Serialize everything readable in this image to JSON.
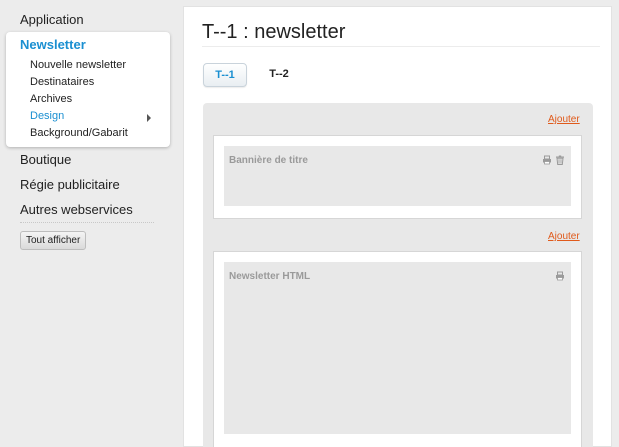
{
  "sidebar": {
    "items": {
      "application": "Application",
      "boutique": "Boutique",
      "regie": "Régie publicitaire",
      "autres": "Autres webservices"
    },
    "active": {
      "title": "Newsletter",
      "sub_items": {
        "nouvelle": "Nouvelle newsletter",
        "destinataires": "Destinataires",
        "archives": "Archives",
        "design": "Design",
        "background": "Background/Gabarit"
      }
    },
    "show_all_label": "Tout afficher"
  },
  "main": {
    "title": "T--1 : newsletter",
    "tabs": {
      "active": "T--1",
      "inactive": "T--2"
    },
    "add_label_1": "Ajouter",
    "add_label_2": "Ajouter",
    "blocks": {
      "banner": "Bannière de titre",
      "newsletter_html": "Newsletter HTML"
    }
  },
  "colors": {
    "accent": "#1a8fd1",
    "link": "#e05a1b"
  },
  "icons": [
    "chevron-right-icon",
    "print-icon",
    "trash-icon"
  ]
}
